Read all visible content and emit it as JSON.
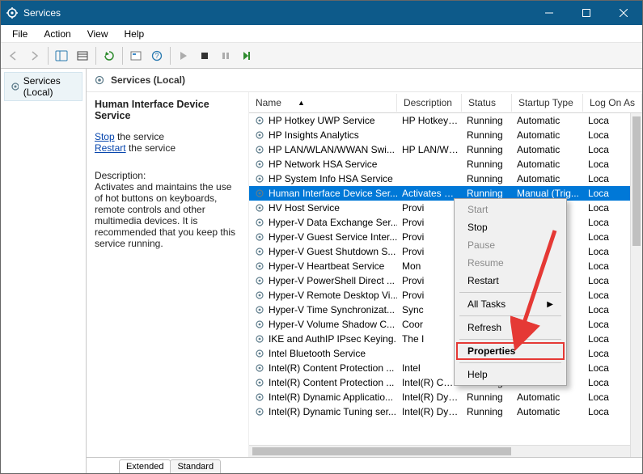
{
  "window": {
    "title": "Services"
  },
  "menu": {
    "file": "File",
    "action": "Action",
    "view": "View",
    "help": "Help"
  },
  "left_tree": {
    "root": "Services (Local)"
  },
  "right_header": {
    "label": "Services (Local)"
  },
  "detail": {
    "service_name": "Human Interface Device Service",
    "stop_label": "Stop",
    "stop_suffix": " the service",
    "restart_label": "Restart",
    "restart_suffix": " the service",
    "desc_heading": "Description:",
    "description": "Activates and maintains the use of hot buttons on keyboards, remote controls and other multimedia devices. It is recommended that you keep this service running."
  },
  "columns": {
    "name": "Name",
    "desc": "Description",
    "status": "Status",
    "start": "Startup Type",
    "log": "Log On As"
  },
  "services": [
    {
      "name": "HP Hotkey UWP Service",
      "desc": "HP Hotkey ...",
      "status": "Running",
      "start": "Automatic",
      "log": "Loca"
    },
    {
      "name": "HP Insights Analytics",
      "desc": "",
      "status": "Running",
      "start": "Automatic",
      "log": "Loca"
    },
    {
      "name": "HP LAN/WLAN/WWAN Swi...",
      "desc": "HP LAN/WL...",
      "status": "Running",
      "start": "Automatic",
      "log": "Loca"
    },
    {
      "name": "HP Network HSA Service",
      "desc": "",
      "status": "Running",
      "start": "Automatic",
      "log": "Loca"
    },
    {
      "name": "HP System Info HSA Service",
      "desc": "",
      "status": "Running",
      "start": "Automatic",
      "log": "Loca"
    },
    {
      "name": "Human Interface Device Ser...",
      "desc": "Activates an...",
      "status": "Running",
      "start": "Manual (Trig...",
      "log": "Loca",
      "selected": true
    },
    {
      "name": "HV Host Service",
      "desc": "Provi",
      "status": "",
      "start": "al (Trig...",
      "log": "Loca"
    },
    {
      "name": "Hyper-V Data Exchange Ser...",
      "desc": "Provi",
      "status": "",
      "start": "al (Trig...",
      "log": "Loca"
    },
    {
      "name": "Hyper-V Guest Service Inter...",
      "desc": "Provi",
      "status": "",
      "start": "al (Trig...",
      "log": "Loca"
    },
    {
      "name": "Hyper-V Guest Shutdown S...",
      "desc": "Provi",
      "status": "",
      "start": "al (Trig...",
      "log": "Loca"
    },
    {
      "name": "Hyper-V Heartbeat Service",
      "desc": "Mon",
      "status": "",
      "start": "al (Trig...",
      "log": "Loca"
    },
    {
      "name": "Hyper-V PowerShell Direct ...",
      "desc": "Provi",
      "status": "",
      "start": "al (Trig...",
      "log": "Loca"
    },
    {
      "name": "Hyper-V Remote Desktop Vi...",
      "desc": "Provi",
      "status": "",
      "start": "al (Trig...",
      "log": "Loca"
    },
    {
      "name": "Hyper-V Time Synchronizat...",
      "desc": "Sync",
      "status": "",
      "start": "al (Trig...",
      "log": "Loca"
    },
    {
      "name": "Hyper-V Volume Shadow C...",
      "desc": "Coor",
      "status": "",
      "start": "al (Trig...",
      "log": "Loca"
    },
    {
      "name": "IKE and AuthIP IPsec Keying...",
      "desc": "The I",
      "status": "",
      "start": "al (Trig...",
      "log": "Loca"
    },
    {
      "name": "Intel Bluetooth Service",
      "desc": "",
      "status": "",
      "start": "atic",
      "log": "Loca"
    },
    {
      "name": "Intel(R) Content Protection ...",
      "desc": "Intel",
      "status": "",
      "start": "atic (T...",
      "log": "Loca"
    },
    {
      "name": "Intel(R) Content Protection ...",
      "desc": "Intel(R) Con...",
      "status": "Running",
      "start": "Manual",
      "log": "Loca"
    },
    {
      "name": "Intel(R) Dynamic Applicatio...",
      "desc": "Intel(R) Dyn...",
      "status": "Running",
      "start": "Automatic",
      "log": "Loca"
    },
    {
      "name": "Intel(R) Dynamic Tuning ser...",
      "desc": "Intel(R) Dyn...",
      "status": "Running",
      "start": "Automatic",
      "log": "Loca"
    }
  ],
  "tabs": {
    "extended": "Extended",
    "standard": "Standard"
  },
  "context_menu": {
    "start": "Start",
    "stop": "Stop",
    "pause": "Pause",
    "resume": "Resume",
    "restart": "Restart",
    "all_tasks": "All Tasks",
    "refresh": "Refresh",
    "properties": "Properties",
    "help": "Help"
  }
}
